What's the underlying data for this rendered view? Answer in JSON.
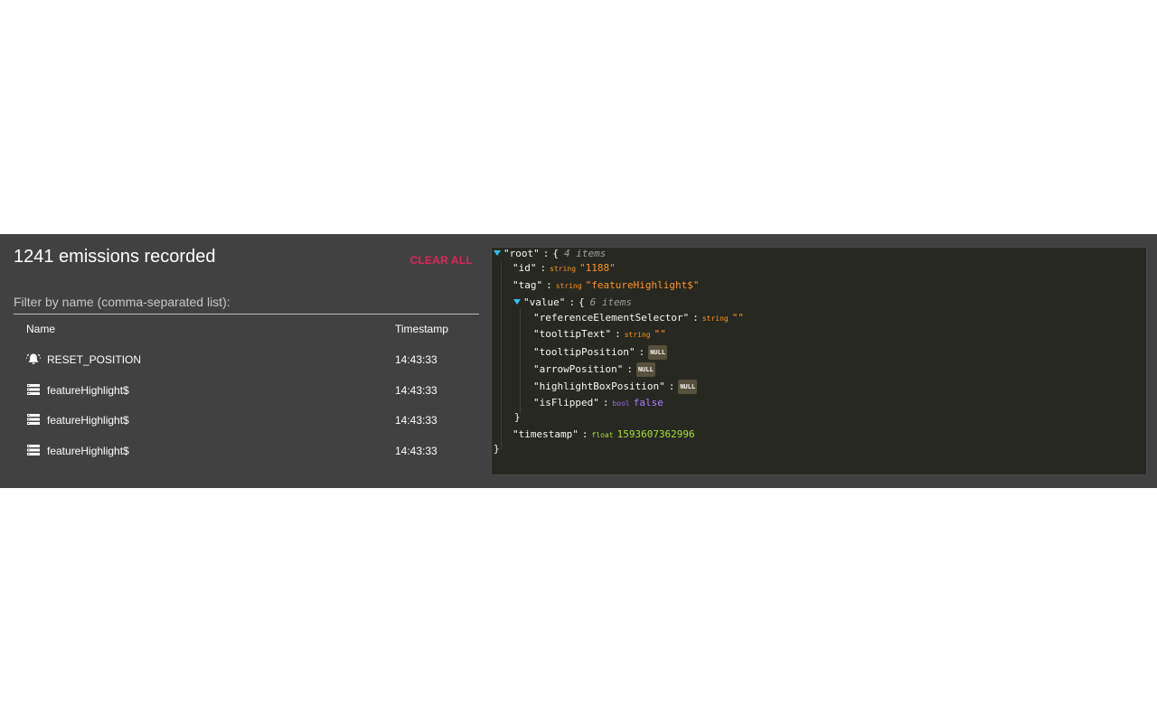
{
  "header": {
    "title": "1241 emissions recorded",
    "clear_label": "CLEAR ALL"
  },
  "filter": {
    "placeholder": "Filter by name (comma-separated list):",
    "value": ""
  },
  "table": {
    "columns": [
      "Name",
      "Timestamp"
    ],
    "rows": [
      {
        "icon": "bell-ring-icon",
        "name": "RESET_POSITION",
        "timestamp": "14:43:33"
      },
      {
        "icon": "storage-list-icon",
        "name": "featureHighlight$",
        "timestamp": "14:43:33"
      },
      {
        "icon": "storage-list-icon",
        "name": "featureHighlight$",
        "timestamp": "14:43:33"
      },
      {
        "icon": "storage-list-icon",
        "name": "featureHighlight$",
        "timestamp": "14:43:33"
      }
    ]
  },
  "json_view": {
    "root_key": "\"root\"",
    "root_count": "4 items",
    "id_key": "\"id\"",
    "id_type": "string",
    "id_value": "\"1188\"",
    "tag_key": "\"tag\"",
    "tag_type": "string",
    "tag_value": "\"featureHighlight$\"",
    "value_key": "\"value\"",
    "value_count": "6 items",
    "res_key": "\"referenceElementSelector\"",
    "res_type": "string",
    "res_value": "\"\"",
    "tt_key": "\"tooltipText\"",
    "tt_type": "string",
    "tt_value": "\"\"",
    "tp_key": "\"tooltipPosition\"",
    "ap_key": "\"arrowPosition\"",
    "hbp_key": "\"highlightBoxPosition\"",
    "null_label": "NULL",
    "flip_key": "\"isFlipped\"",
    "flip_type": "bool",
    "flip_value": "false",
    "ts_key": "\"timestamp\"",
    "ts_type": "float",
    "ts_value": "1593607362996",
    "open_brace": "{",
    "close_brace": "}",
    "colon": ":"
  },
  "colors": {
    "panel_bg": "#414141",
    "json_bg": "#272822",
    "accent": "#e0245e",
    "string": "#fd971f",
    "float": "#a6e22e",
    "bool": "#ae81ff",
    "expander": "#2ac3f0"
  }
}
